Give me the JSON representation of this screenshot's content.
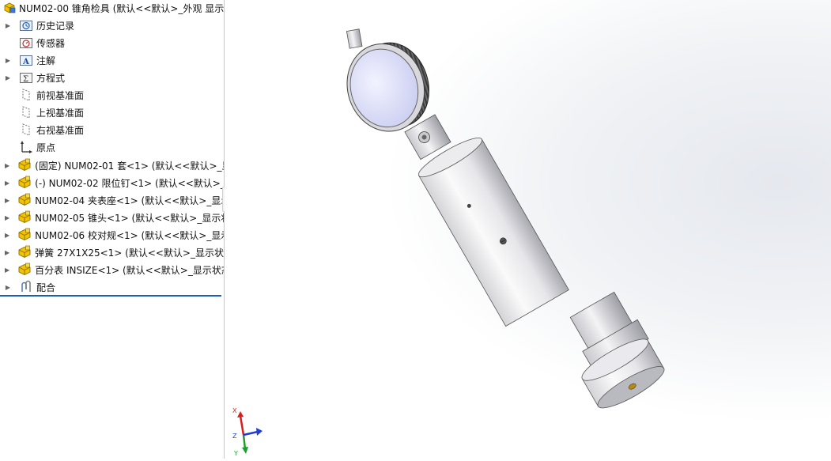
{
  "tree": {
    "root_label": "NUM02-00 锥角检具  (默认<<默认>_外观 显示",
    "items": [
      {
        "label": "历史记录",
        "expandable": true,
        "icon": "history-folder-icon"
      },
      {
        "label": "传感器",
        "expandable": false,
        "icon": "sensor-folder-icon"
      },
      {
        "label": "注解",
        "expandable": true,
        "icon": "annotation-folder-icon"
      },
      {
        "label": "方程式",
        "expandable": true,
        "icon": "equation-folder-icon"
      },
      {
        "label": "前视基准面",
        "expandable": false,
        "icon": "plane-icon"
      },
      {
        "label": "上视基准面",
        "expandable": false,
        "icon": "plane-icon"
      },
      {
        "label": "右视基准面",
        "expandable": false,
        "icon": "plane-icon"
      },
      {
        "label": "原点",
        "expandable": false,
        "icon": "origin-icon"
      },
      {
        "label": "(固定) NUM02-01 套<1> (默认<<默认>_显",
        "expandable": true,
        "icon": "part-icon"
      },
      {
        "label": "(-) NUM02-02 限位钉<1> (默认<<默认>_",
        "expandable": true,
        "icon": "part-icon"
      },
      {
        "label": "NUM02-04 夹表座<1> (默认<<默认>_显示",
        "expandable": true,
        "icon": "part-icon"
      },
      {
        "label": "NUM02-05 锥头<1> (默认<<默认>_显示状",
        "expandable": true,
        "icon": "part-icon"
      },
      {
        "label": "NUM02-06 校对规<1> (默认<<默认>_显示",
        "expandable": true,
        "icon": "part-icon"
      },
      {
        "label": "弹簧 27X1X25<1> (默认<<默认>_显示状态",
        "expandable": true,
        "icon": "part-icon"
      },
      {
        "label": "百分表 INSIZE<1> (默认<<默认>_显示状态",
        "expandable": true,
        "icon": "part-icon"
      },
      {
        "label": "配合",
        "expandable": true,
        "icon": "mates-icon"
      }
    ]
  },
  "triad": {
    "x": "X",
    "y": "Y",
    "z": "Z"
  },
  "colors": {
    "accent": "#1a5fb4",
    "part_yellow": "#f2c300",
    "axis_x": "#d62020",
    "axis_y": "#1e9e2e",
    "axis_z": "#1f3fd0"
  }
}
